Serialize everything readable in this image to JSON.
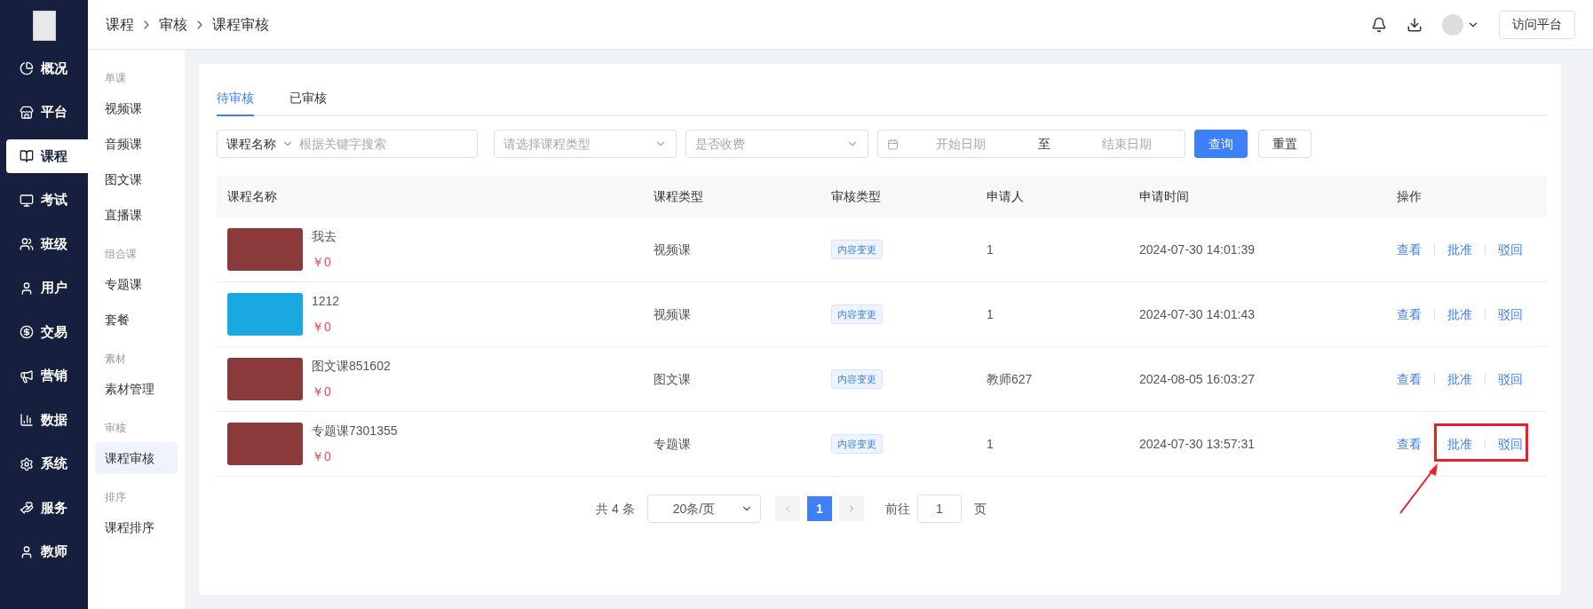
{
  "nav": [
    {
      "label": "概况",
      "selected": false
    },
    {
      "label": "平台",
      "selected": false
    },
    {
      "label": "课程",
      "selected": true
    },
    {
      "label": "考试",
      "selected": false
    },
    {
      "label": "班级",
      "selected": false
    },
    {
      "label": "用户",
      "selected": false
    },
    {
      "label": "交易",
      "selected": false
    },
    {
      "label": "营销",
      "selected": false
    },
    {
      "label": "数据",
      "selected": false
    },
    {
      "label": "系统",
      "selected": false
    },
    {
      "label": "服务",
      "selected": false
    },
    {
      "label": "教师",
      "selected": false
    }
  ],
  "subnav": [
    {
      "title": "单课",
      "items": [
        {
          "label": "视频课",
          "selected": false
        },
        {
          "label": "音频课",
          "selected": false
        },
        {
          "label": "图文课",
          "selected": false
        },
        {
          "label": "直播课",
          "selected": false
        }
      ]
    },
    {
      "title": "组合课",
      "items": [
        {
          "label": "专题课",
          "selected": false
        },
        {
          "label": "套餐",
          "selected": false
        }
      ]
    },
    {
      "title": "素材",
      "items": [
        {
          "label": "素材管理",
          "selected": false
        }
      ]
    },
    {
      "title": "审核",
      "items": [
        {
          "label": "课程审核",
          "selected": true
        }
      ]
    },
    {
      "title": "排序",
      "items": [
        {
          "label": "课程排序",
          "selected": false
        }
      ]
    }
  ],
  "breadcrumb": [
    "课程",
    "审核",
    "课程审核"
  ],
  "header_button": "访问平台",
  "tabs": [
    {
      "label": "待审核",
      "selected": true
    },
    {
      "label": "已审核",
      "selected": false
    }
  ],
  "filters": {
    "search_type": "课程名称",
    "search_placeholder": "根据关键字搜索",
    "type_placeholder": "请选择课程类型",
    "fee_placeholder": "是否收费",
    "start_placeholder": "开始日期",
    "range_separator": "至",
    "end_placeholder": "结束日期",
    "query_button": "查询",
    "reset_button": "重置"
  },
  "table": {
    "columns": [
      "课程名称",
      "课程类型",
      "审核类型",
      "申请人",
      "申请时间",
      "操作"
    ],
    "rows": [
      {
        "kind": "photo",
        "name": "我去",
        "price": "￥0",
        "type": "视频课",
        "audit_type": "内容变更",
        "applicant": "1",
        "time": "2024-07-30 14:01:39",
        "actions": [
          "查看",
          "批准",
          "驳回"
        ],
        "highlighted": false
      },
      {
        "kind": "logo",
        "name": "1212",
        "price": "￥0",
        "type": "视频课",
        "audit_type": "内容变更",
        "applicant": "1",
        "time": "2024-07-30 14:01:43",
        "actions": [
          "查看",
          "批准",
          "驳回"
        ],
        "highlighted": false
      },
      {
        "kind": "photo",
        "name": "图文课851602",
        "price": "￥0",
        "type": "图文课",
        "audit_type": "内容变更",
        "applicant": "教师627",
        "time": "2024-08-05 16:03:27",
        "actions": [
          "查看",
          "批准",
          "驳回"
        ],
        "highlighted": false
      },
      {
        "kind": "photo",
        "name": "专题课7301355",
        "price": "￥0",
        "type": "专题课",
        "audit_type": "内容变更",
        "applicant": "1",
        "time": "2024-07-30 13:57:31",
        "actions": [
          "查看",
          "批准",
          "驳回"
        ],
        "highlighted": true
      }
    ]
  },
  "pagination": {
    "total": "共 4 条",
    "page_size": "20条/页",
    "pages": [
      {
        "label": "1",
        "selected": true
      }
    ],
    "goto_label": "前往",
    "goto_value": "1",
    "goto_suffix": "页"
  }
}
